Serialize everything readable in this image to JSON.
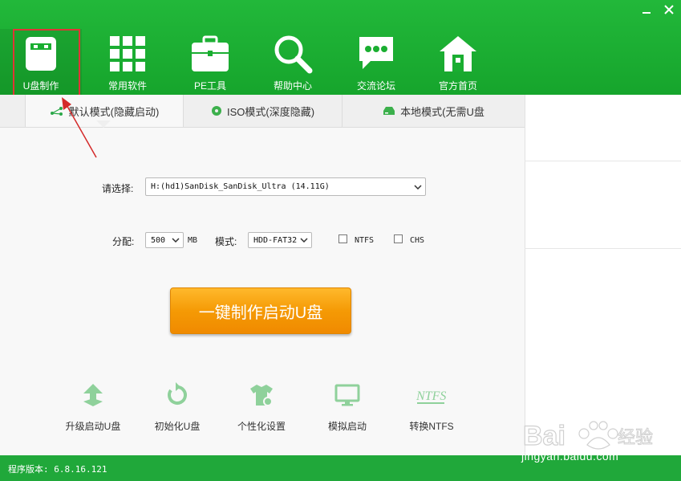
{
  "nav": [
    {
      "label": "U盘制作",
      "icon": "usb-drive-icon"
    },
    {
      "label": "常用软件",
      "icon": "grid-apps-icon"
    },
    {
      "label": "PE工具",
      "icon": "toolbox-icon"
    },
    {
      "label": "帮助中心",
      "icon": "magnifier-icon"
    },
    {
      "label": "交流论坛",
      "icon": "chat-bubble-icon"
    },
    {
      "label": "官方首页",
      "icon": "home-icon"
    }
  ],
  "tabs": [
    {
      "label": "默认模式(隐藏启动)",
      "icon": "share-nodes-icon"
    },
    {
      "label": "ISO模式(深度隐藏)",
      "icon": "disc-icon"
    },
    {
      "label": "本地模式(无需U盘",
      "icon": "local-disk-icon"
    }
  ],
  "form": {
    "select_label": "请选择:",
    "device_value": "H:(hd1)SanDisk_SanDisk_Ultra (14.11G)",
    "partition_label": "分配:",
    "partition_value": "500",
    "partition_unit": "MB",
    "mode_label": "模式:",
    "mode_value": "HDD-FAT32",
    "ntfs_label": "NTFS",
    "chs_label": "CHS"
  },
  "main_button": "一键制作启动U盘",
  "tools": [
    {
      "label": "升级启动U盘",
      "icon": "upgrade-icon"
    },
    {
      "label": "初始化U盘",
      "icon": "reset-icon"
    },
    {
      "label": "个性化设置",
      "icon": "shirt-settings-icon"
    },
    {
      "label": "模拟启动",
      "icon": "monitor-icon"
    },
    {
      "label": "转换NTFS",
      "icon": "ntfs-icon"
    }
  ],
  "status": {
    "version": "程序版本: 6.8.16.121"
  },
  "watermark": {
    "text": "jingyan.baidu.com",
    "logo": "Bai 经验"
  },
  "colors": {
    "brand_green": "#1aae31",
    "button_orange": "#f59a05",
    "annotation_red": "#e03535"
  }
}
